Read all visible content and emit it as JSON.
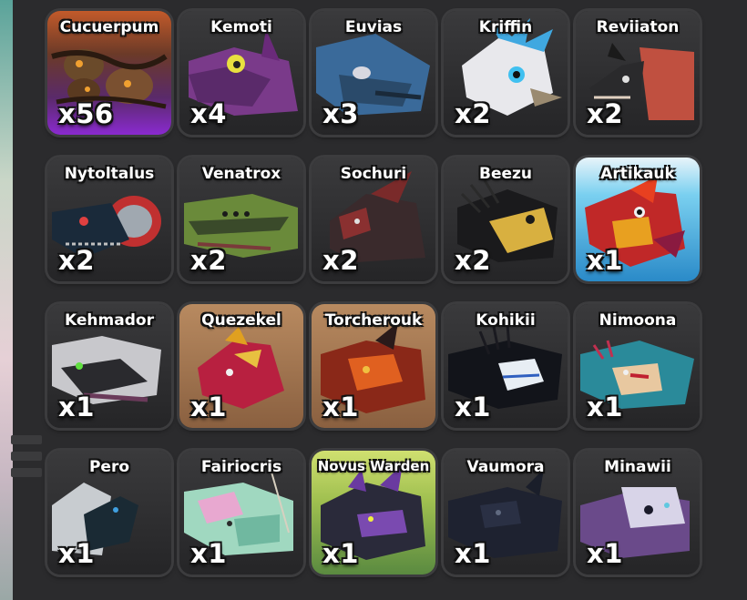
{
  "inventory": {
    "items": [
      {
        "name": "Cucuerpum",
        "count": "x56"
      },
      {
        "name": "Kemoti",
        "count": "x4"
      },
      {
        "name": "Euvias",
        "count": "x3"
      },
      {
        "name": "Kriffin",
        "count": "x2"
      },
      {
        "name": "Reviiaton",
        "count": "x2"
      },
      {
        "name": "Nytoltalus",
        "count": "x2"
      },
      {
        "name": "Venatrox",
        "count": "x2"
      },
      {
        "name": "Sochuri",
        "count": "x2"
      },
      {
        "name": "Beezu",
        "count": "x2"
      },
      {
        "name": "Artikauk",
        "count": "x1"
      },
      {
        "name": "Kehmador",
        "count": "x1"
      },
      {
        "name": "Quezekel",
        "count": "x1"
      },
      {
        "name": "Torcherouk",
        "count": "x1"
      },
      {
        "name": "Kohikii",
        "count": "x1"
      },
      {
        "name": "Nimoona",
        "count": "x1"
      },
      {
        "name": "Pero",
        "count": "x1"
      },
      {
        "name": "Fairiocris",
        "count": "x1"
      },
      {
        "name": "Novus Warden",
        "count": "x1"
      },
      {
        "name": "Vaumora",
        "count": "x1"
      },
      {
        "name": "Minawii",
        "count": "x1"
      }
    ]
  },
  "colors": {
    "panel_background": "#2b2b2d",
    "card_border": "#3c3c3e",
    "label_text": "#ffffff"
  }
}
